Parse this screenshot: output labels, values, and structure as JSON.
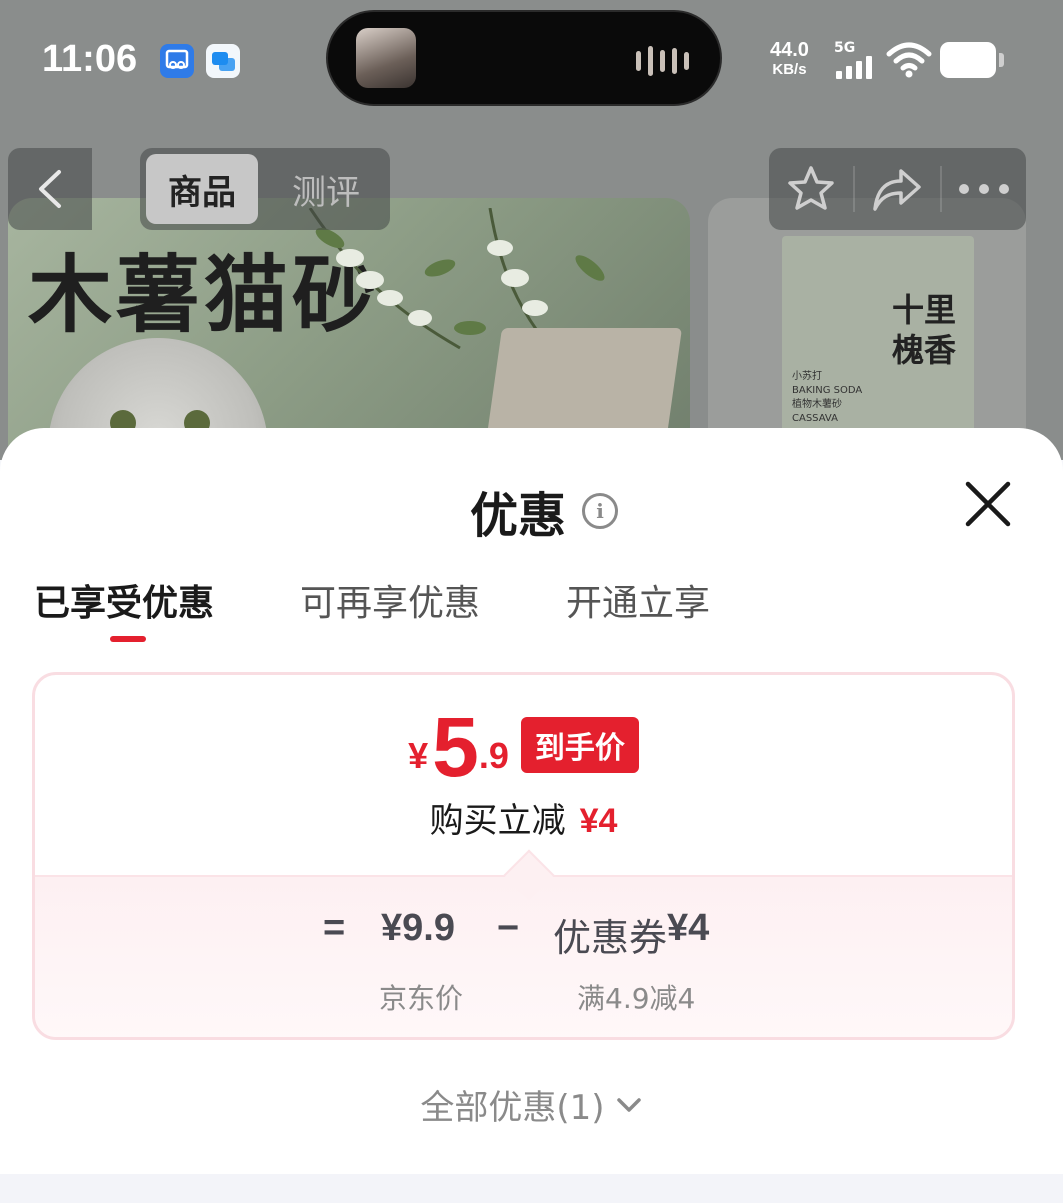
{
  "status_bar": {
    "time": "11:06",
    "net_speed_value": "44.0",
    "net_speed_unit": "KB/s",
    "network": "5G"
  },
  "nav": {
    "tab_goods": "商品",
    "tab_reviews": "测评"
  },
  "product_images": {
    "hero_title": "木薯猫砂",
    "side_pack_title": "十里槐香",
    "side_pack_line1": "小苏打",
    "side_pack_line2": "BAKING SODA",
    "side_pack_line3": "植物木薯砂",
    "side_pack_line4": "CASSAVA"
  },
  "sheet": {
    "title": "优惠",
    "tabs": [
      "已享受优惠",
      "可再享优惠",
      "开通立享"
    ],
    "active_tab_index": 0,
    "deal": {
      "currency": "¥",
      "price_int": "5",
      "price_dec": ".9",
      "price_tag": "到手价",
      "discount_label": "购买立减",
      "discount_amount": "¥4",
      "calc_equals": "=",
      "calc_base_price": "¥9.9",
      "calc_minus": "−",
      "calc_coupon_label": "优惠券",
      "calc_coupon_amount": "¥4",
      "calc_base_label": "京东价",
      "calc_coupon_rule": "满4.9减4"
    },
    "all_deals": "全部优惠(1)"
  },
  "colors": {
    "accent": "#e4202e",
    "card_border": "#f9dde2"
  }
}
